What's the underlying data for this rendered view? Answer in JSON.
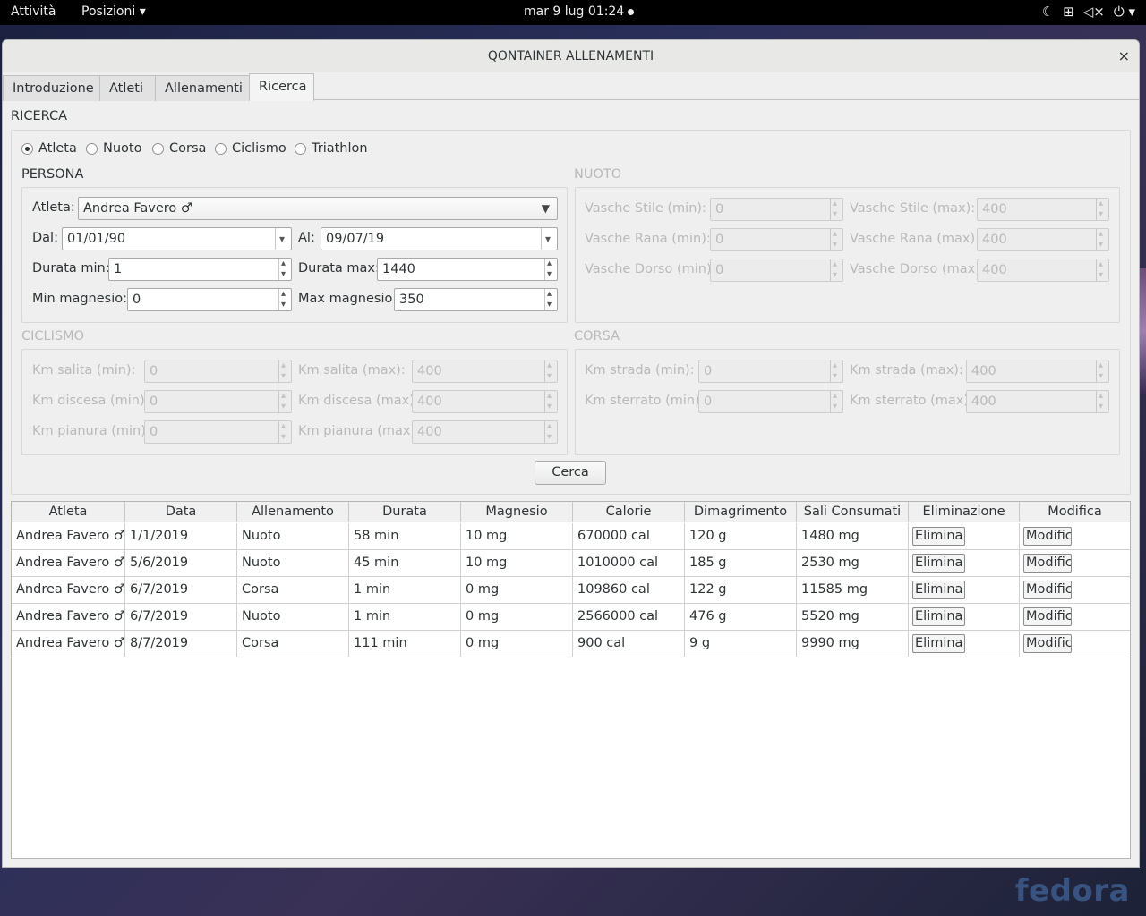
{
  "topbar": {
    "activities": "Attività",
    "places": "Posizioni ▾",
    "clock": "mar 9 lug  01:24",
    "tray_icons": [
      "night-light-icon",
      "network-icon",
      "volume-muted-icon",
      "power-icon"
    ]
  },
  "wallpaper_logo": "fedora",
  "window": {
    "title": "QONTAINER ALLENAMENTI",
    "close_glyph": "×"
  },
  "tabs": [
    "Introduzione",
    "Atleti",
    "Allenamenti",
    "Ricerca"
  ],
  "active_tab": "Ricerca",
  "search": {
    "section_title": "RICERCA",
    "radios": [
      {
        "label": "Atleta",
        "checked": true
      },
      {
        "label": "Nuoto",
        "checked": false
      },
      {
        "label": "Corsa",
        "checked": false
      },
      {
        "label": "Ciclismo",
        "checked": false
      },
      {
        "label": "Triathlon",
        "checked": false
      }
    ],
    "persona": {
      "title": "PERSONA",
      "atleta_label": "Atleta:",
      "atleta_value": "Andrea Favero ♂",
      "dal_label": "Dal:",
      "dal_value": "01/01/90",
      "al_label": "Al:",
      "al_value": "09/07/19",
      "durata_min_label": "Durata min:",
      "durata_min_value": "1",
      "durata_max_label": "Durata max:",
      "durata_max_value": "1440",
      "min_magnesio_label": "Min magnesio:",
      "min_magnesio_value": "0",
      "max_magnesio_label": "Max magnesio:",
      "max_magnesio_value": "350"
    },
    "nuoto": {
      "title": "NUOTO",
      "rows": [
        {
          "min_label": "Vasche Stile (min):",
          "min_value": "0",
          "max_label": "Vasche Stile (max):",
          "max_value": "400"
        },
        {
          "min_label": "Vasche Rana (min):",
          "min_value": "0",
          "max_label": "Vasche Rana (max):",
          "max_value": "400"
        },
        {
          "min_label": "Vasche Dorso (min):",
          "min_value": "0",
          "max_label": "Vasche Dorso (max):",
          "max_value": "400"
        }
      ]
    },
    "ciclismo": {
      "title": "CICLISMO",
      "rows": [
        {
          "min_label": "Km salita (min):",
          "min_value": "0",
          "max_label": "Km salita (max):",
          "max_value": "400"
        },
        {
          "min_label": "Km discesa (min):",
          "min_value": "0",
          "max_label": "Km discesa (max):",
          "max_value": "400"
        },
        {
          "min_label": "Km pianura (min):",
          "min_value": "0",
          "max_label": "Km pianura (max):",
          "max_value": "400"
        }
      ]
    },
    "corsa": {
      "title": "CORSA",
      "rows": [
        {
          "min_label": "Km strada (min):",
          "min_value": "0",
          "max_label": "Km strada (max):",
          "max_value": "400"
        },
        {
          "min_label": "Km sterrato (min):",
          "min_value": "0",
          "max_label": "Km sterrato (max):",
          "max_value": "400"
        }
      ]
    },
    "search_button": "Cerca"
  },
  "results": {
    "columns": [
      "Atleta",
      "Data",
      "Allenamento",
      "Durata",
      "Magnesio",
      "Calorie",
      "Dimagrimento",
      "Sali Consumati",
      "Eliminazione",
      "Modifica"
    ],
    "delete_label": "Elimina",
    "edit_label": "Modifica",
    "rows": [
      [
        "Andrea Favero ♂",
        "1/1/2019",
        "Nuoto",
        "58 min",
        "10 mg",
        "670000 cal",
        "120 g",
        "1480 mg"
      ],
      [
        "Andrea Favero ♂",
        "5/6/2019",
        "Nuoto",
        "45 min",
        "10 mg",
        "1010000 cal",
        "185 g",
        "2530 mg"
      ],
      [
        "Andrea Favero ♂",
        "6/7/2019",
        "Corsa",
        "1 min",
        "0 mg",
        "109860 cal",
        "122 g",
        "11585 mg"
      ],
      [
        "Andrea Favero ♂",
        "6/7/2019",
        "Nuoto",
        "1 min",
        "0 mg",
        "2566000 cal",
        "476 g",
        "5520 mg"
      ],
      [
        "Andrea Favero ♂",
        "8/7/2019",
        "Corsa",
        "111 min",
        "0 mg",
        "900 cal",
        "9 g",
        "9990 mg"
      ]
    ]
  }
}
